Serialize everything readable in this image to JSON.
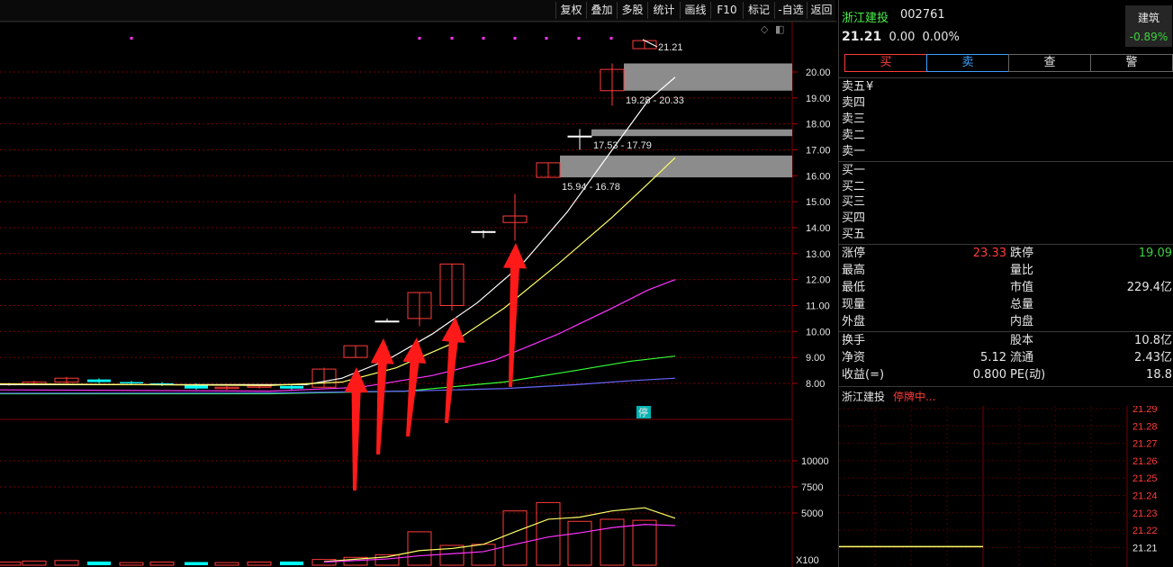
{
  "toolbar": {
    "buttons": [
      "复权",
      "叠加",
      "多股",
      "统计",
      "画线",
      "F10",
      "标记",
      "-自选",
      "返回"
    ]
  },
  "chart_icons": {
    "diamond": "◇",
    "panel": "◧"
  },
  "kline": {
    "last_price_label": "21.21",
    "price_axis": [
      "20.00",
      "19.00",
      "18.00",
      "17.00",
      "16.00",
      "15.00",
      "14.00",
      "13.00",
      "12.00",
      "11.00",
      "10.00",
      "9.00",
      "8.00"
    ],
    "gaps": [
      {
        "low": 19.28,
        "high": 20.33,
        "label": "19.28 - 20.33"
      },
      {
        "low": 17.53,
        "high": 17.79,
        "label": "17.53 - 17.79"
      },
      {
        "low": 15.94,
        "high": 16.78,
        "label": "15.94 - 16.78"
      }
    ],
    "suspend_badge": "停"
  },
  "volume": {
    "axis": [
      "10000",
      "7500",
      "5000"
    ],
    "unit": "X100"
  },
  "quote": {
    "name": "浙江建投",
    "code": "002761",
    "price": "21.21",
    "change": "0.00",
    "change_pct": "0.00%",
    "sector": "建筑",
    "sector_change": "-0.89%",
    "sector_change_color": "#3dd13d"
  },
  "trade_buttons": [
    {
      "label": "买",
      "color": "#ff3b3b",
      "border": "#ff3b3b"
    },
    {
      "label": "卖",
      "color": "#3da0ff",
      "border": "#3da0ff"
    },
    {
      "label": "查",
      "color": "#e6e6e6",
      "border": "#666666"
    },
    {
      "label": "警",
      "color": "#e6e6e6",
      "border": "#666666"
    }
  ],
  "orderbook": {
    "sell": [
      "卖五",
      "卖四",
      "卖三",
      "卖二",
      "卖一"
    ],
    "sell_currency": "¥",
    "buy": [
      "买一",
      "买二",
      "买三",
      "买四",
      "买五"
    ]
  },
  "stats": {
    "limit_up_label": "涨停",
    "limit_up": "23.33",
    "limit_down_label": "跌停",
    "limit_down": "19.09",
    "high_label": "最高",
    "vol_ratio_label": "量比",
    "low_label": "最低",
    "mkt_cap_label": "市值",
    "mkt_cap": "229.4亿",
    "current_vol_label": "现量",
    "total_vol_label": "总量",
    "outer_label": "外盘",
    "inner_label": "内盘",
    "turnover_label": "换手",
    "share_cap_label": "股本",
    "share_cap": "10.8亿",
    "nav_label": "净资",
    "nav": "5.12",
    "float_label": "流通",
    "float": "2.43亿",
    "eps_label": "收益(=)",
    "eps": "0.800",
    "pe_label": "PE(动)",
    "pe": "18.8"
  },
  "minichart": {
    "title": "浙江建投",
    "status": "停牌中...",
    "axis": [
      "21.29",
      "21.28",
      "21.27",
      "21.26",
      "21.25",
      "21.24",
      "21.23",
      "21.22",
      "21.21"
    ]
  },
  "colors": {
    "up": "#ff3b3b",
    "down": "#00ffff",
    "ma5": "#ffffff",
    "ma10": "#ffff66",
    "ma20": "#ff33ff",
    "ma30": "#33ff33",
    "ma60": "#6666ff",
    "dot": "#ff33ff",
    "grid": "#7a0000"
  }
}
